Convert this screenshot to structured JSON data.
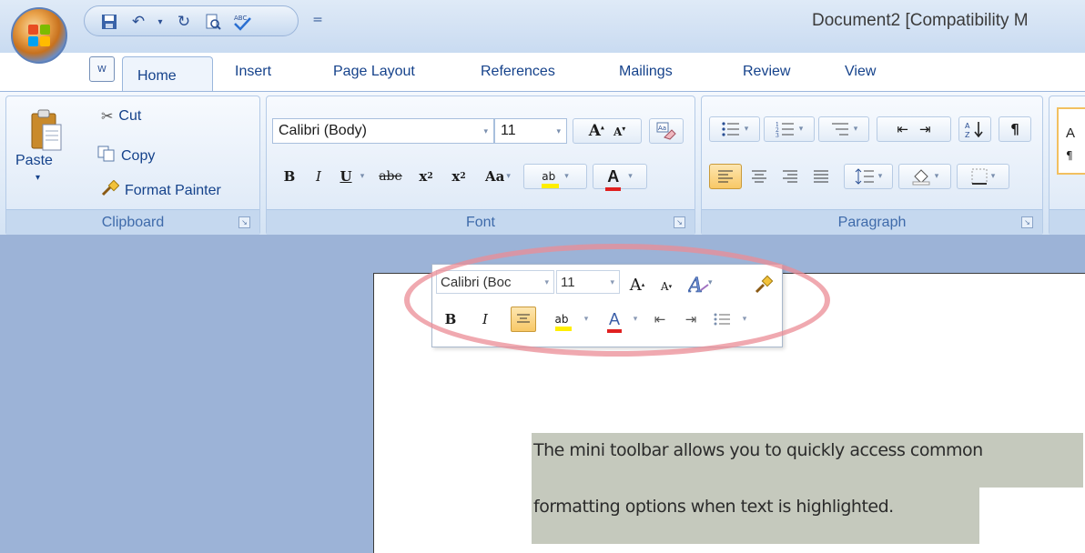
{
  "window": {
    "title": "Document2 [Compatibility M"
  },
  "quick_access": {
    "customize_glyph": "="
  },
  "tabs": [
    "Home",
    "Insert",
    "Page Layout",
    "References",
    "Mailings",
    "Review",
    "View"
  ],
  "clipboard": {
    "paste_label": "Paste",
    "cut_label": "Cut",
    "copy_label": "Copy",
    "format_painter_label": "Format Painter",
    "group_label": "Clipboard"
  },
  "font": {
    "font_name": "Calibri (Body)",
    "font_size": "11",
    "grow_label": "A",
    "shrink_label": "A",
    "group_label": "Font",
    "bold": "B",
    "italic": "I",
    "underline": "U",
    "strikethrough": "abe",
    "subscript": "x",
    "superscript": "x",
    "change_case": "Aa",
    "highlight": "ab",
    "font_color": "A"
  },
  "paragraph": {
    "group_label": "Paragraph",
    "show_marks": "¶"
  },
  "styles_partial": {
    "letter_top": "A",
    "letter_bottom": "¶"
  },
  "mini_toolbar": {
    "font_name": "Calibri (Boc",
    "font_size": "11",
    "bold": "B",
    "italic": "I",
    "highlight": "ab",
    "font_color": "A"
  },
  "document": {
    "line1": "The mini toolbar allows you to quickly access common",
    "line2": "formatting options when text is highlighted."
  },
  "colors": {
    "ribbon_text": "#15428b",
    "workspace": "#9cb3d7",
    "selection": "#c5c9bd",
    "callout_ellipse": "#eb8c96",
    "font_color_red": "#e02020",
    "highlight_yellow": "#ffee00"
  }
}
